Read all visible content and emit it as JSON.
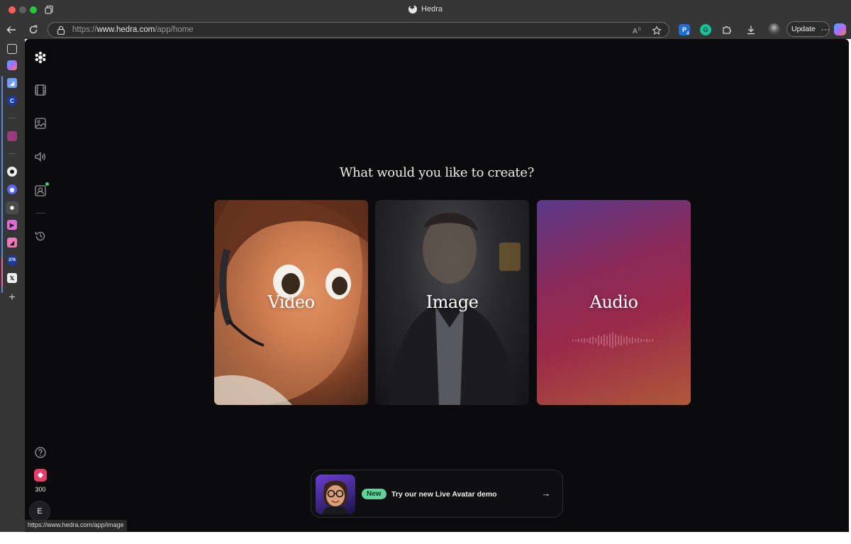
{
  "window": {
    "title": "Hedra",
    "url_scheme": "https://",
    "url_host": "www.hedra.com",
    "url_path": "/app/home",
    "update_label": "Update",
    "update_more": "···"
  },
  "extensions": {
    "pw_badge": "4"
  },
  "vertical_tabs": {
    "counter_badge": "376",
    "active_index": 8
  },
  "app": {
    "rail_icons": [
      "logo-icon",
      "video-icon",
      "image-icon",
      "audio-icon",
      "avatar-icon",
      "history-icon"
    ],
    "help_icon": "help-icon",
    "credits": "300",
    "user_initial": "E"
  },
  "main": {
    "prompt": "What would you like to create?",
    "cards": [
      {
        "label": "Video"
      },
      {
        "label": "Image"
      },
      {
        "label": "Audio"
      }
    ]
  },
  "banner": {
    "badge": "New",
    "text": "Try our new Live Avatar demo",
    "arrow": "→"
  },
  "status_bar": {
    "hover_url": "https://www.hedra.com/app/image"
  },
  "colors": {
    "app_bg": "#0b0b0d",
    "chrome_bg": "#363636",
    "badge_green": "#5fd39a",
    "credits_pink": "#e2406a"
  }
}
